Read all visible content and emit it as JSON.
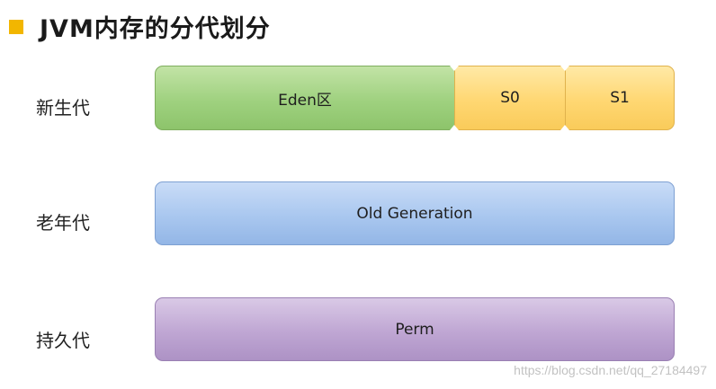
{
  "title": {
    "text": "JVM内存的分代划分",
    "bullet_color": "#f2b600"
  },
  "rows": {
    "young": {
      "label": "新生代",
      "eden": "Eden区",
      "s0": "S0",
      "s1": "S1",
      "eden_color": "#9fd17f",
      "survivor_color": "#ffd772"
    },
    "old": {
      "label": "老年代",
      "block": "Old Generation",
      "color": "#a9c7ef"
    },
    "perm": {
      "label": "持久代",
      "block": "Perm",
      "color": "#bfa6d3"
    }
  },
  "watermark": "https://blog.csdn.net/qq_27184497"
}
